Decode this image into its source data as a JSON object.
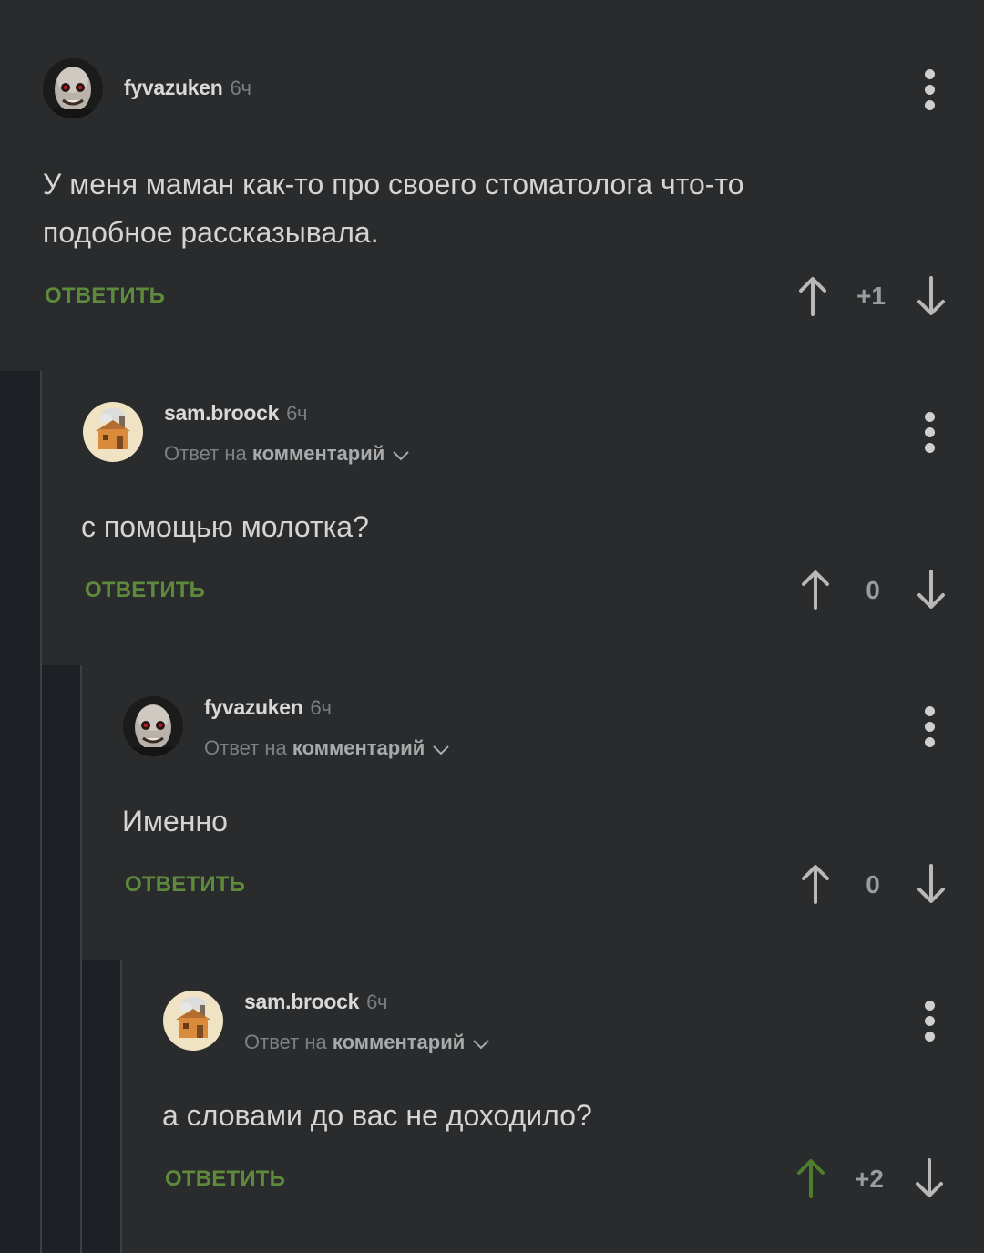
{
  "comments": [
    {
      "username": "fyvazuken",
      "time": "6ч",
      "reply_prefix": "",
      "reply_target": "",
      "text": "У меня маман как-то про своего стоматолога что-то подобное рассказывала.",
      "reply_label": "ОТВЕТИТЬ",
      "score": "+1",
      "upvoted": false,
      "avatar": "bald-man-avatar"
    },
    {
      "username": "sam.broock",
      "time": "6ч",
      "reply_prefix": "Ответ на",
      "reply_target": "комментарий",
      "text": "с помощью молотка?",
      "reply_label": "ОТВЕТИТЬ",
      "score": "0",
      "upvoted": false,
      "avatar": "house-avatar"
    },
    {
      "username": "fyvazuken",
      "time": "6ч",
      "reply_prefix": "Ответ на",
      "reply_target": "комментарий",
      "text": "Именно",
      "reply_label": "ОТВЕТИТЬ",
      "score": "0",
      "upvoted": false,
      "avatar": "bald-man-avatar"
    },
    {
      "username": "sam.broock",
      "time": "6ч",
      "reply_prefix": "Ответ на",
      "reply_target": "комментарий",
      "text": "а словами до вас не доходило?",
      "reply_label": "ОТВЕТИТЬ",
      "score": "+2",
      "upvoted": true,
      "avatar": "house-avatar"
    }
  ],
  "colors": {
    "background": "#2a2b2c",
    "rail": "#1d2125",
    "accent_green": "#5e8a3c",
    "upvote_active": "#4f7d2f"
  }
}
